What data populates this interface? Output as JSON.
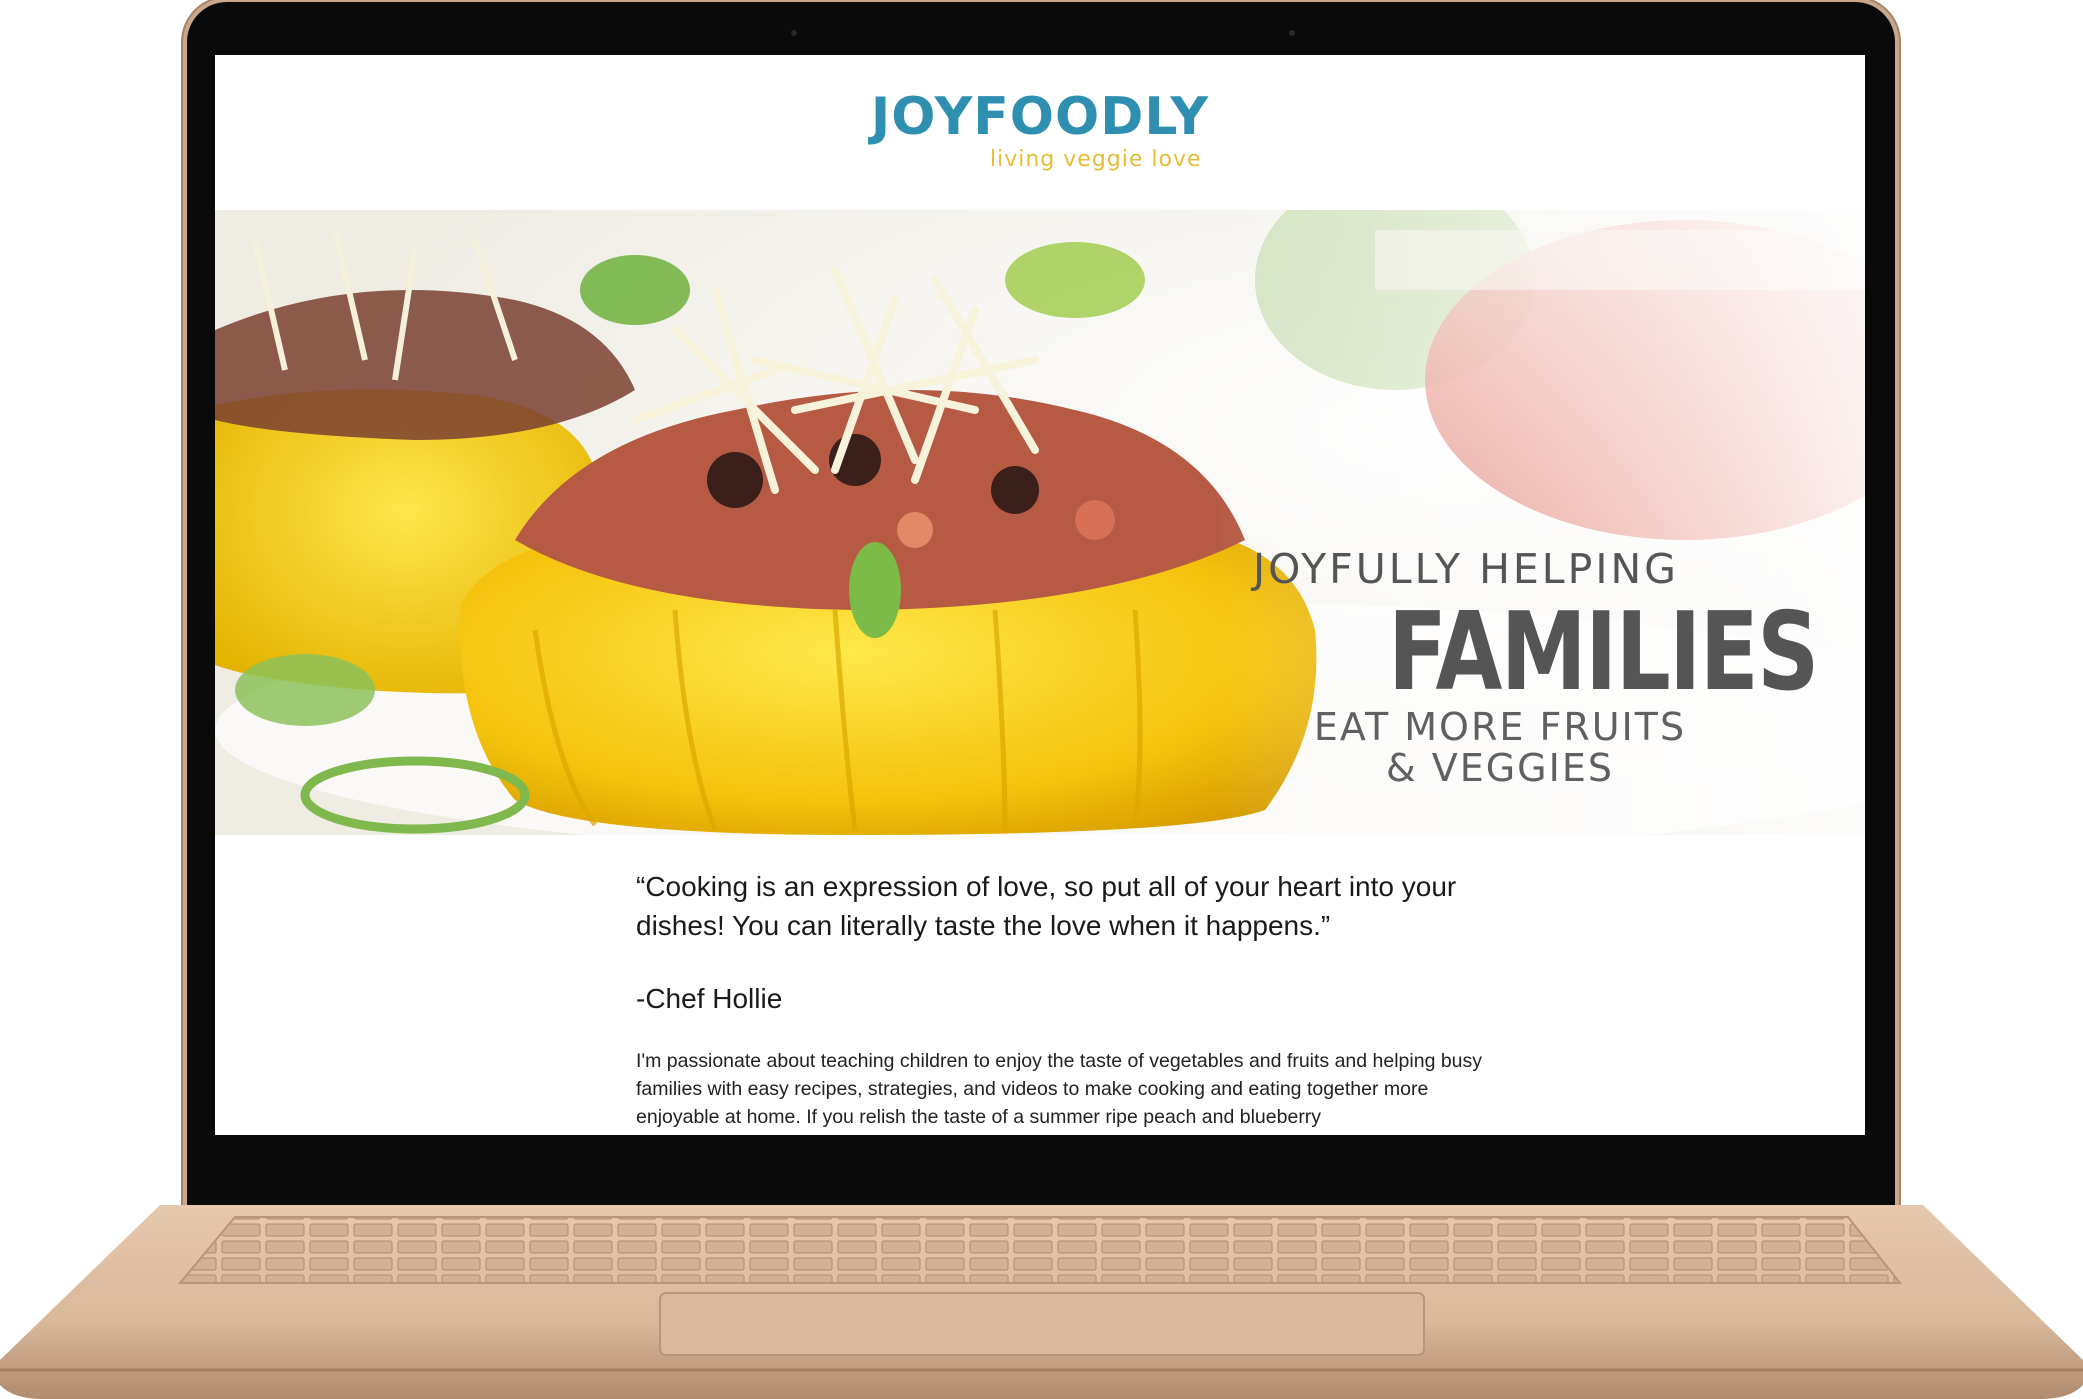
{
  "site": {
    "logo": {
      "name": "JOYFOODLY",
      "tagline": "living veggie love"
    },
    "hero": {
      "line1": "JOYFULLY HELPING",
      "line2": "FAMILIES",
      "line3": [
        "EAT MORE FRUITS",
        "& VEGGIES"
      ]
    },
    "quote": "“Cooking is an expression of love, so put all of your heart into your dishes! You can literally taste the love when it happens.”",
    "author": "-Chef Hollie",
    "bio": "I'm passionate about teaching children to enjoy the taste of vegetables and fruits and helping busy families with easy recipes, strategies, and videos to make cooking and eating together more enjoyable at home. If you relish the taste of a summer ripe peach and blueberry"
  },
  "colors": {
    "brand_blue": "#2f8fb1",
    "brand_yellow": "#e6bd35",
    "hero_text": "#555555",
    "laptop_body": "#d9b89c",
    "bezel": "#0a0a0a"
  }
}
